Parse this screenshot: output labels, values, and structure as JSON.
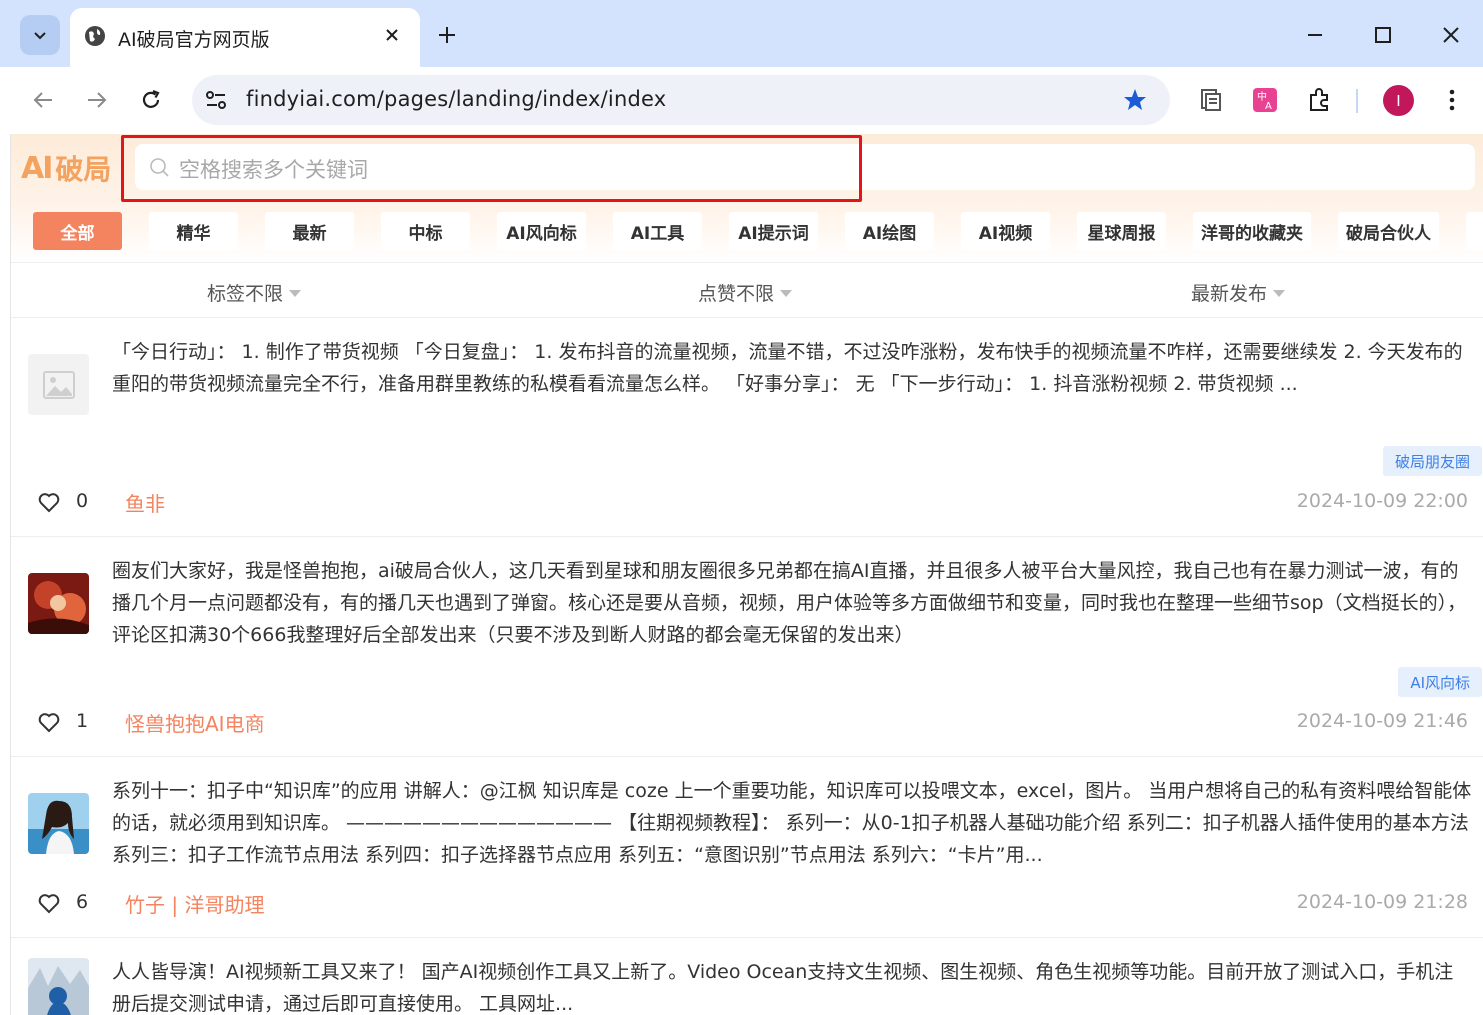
{
  "browser": {
    "tab_title": "AI破局官方网页版",
    "url": "findyiai.com/pages/landing/index/index",
    "profile_initial": "I",
    "accent_color": "#d3e3fd"
  },
  "header": {
    "logo_mark": "AI",
    "logo_text": "破局",
    "search_placeholder": "空格搜索多个关键词",
    "highlight_color": "#e3151a"
  },
  "categories": [
    {
      "label": "全部",
      "active": true
    },
    {
      "label": "精华"
    },
    {
      "label": "最新"
    },
    {
      "label": "中标"
    },
    {
      "label": "AI风向标"
    },
    {
      "label": "AI工具"
    },
    {
      "label": "AI提示词"
    },
    {
      "label": "AI绘图"
    },
    {
      "label": "AI视频"
    },
    {
      "label": "星球周报"
    },
    {
      "label": "洋哥的收藏夹"
    },
    {
      "label": "破局合伙人"
    }
  ],
  "filters": [
    {
      "label": "标签不限"
    },
    {
      "label": "点赞不限"
    },
    {
      "label": "最新发布"
    }
  ],
  "posts": [
    {
      "text": "「今日行动」： 1. 制作了带货视频 「今日复盘」： 1. 发布抖音的流量视频，流量不错，不过没咋涨粉，发布快手的视频流量不咋样，还需要继续发 2. 今天发布的重阳的带货视频流量完全不行，准备用群里教练的私模看看流量怎么样。 「好事分享」： 无 「下一步行动」： 1. 抖音涨粉视频 2. 带货视频 ...",
      "tag": "破局朋友圈",
      "likes": "0",
      "author": "鱼非",
      "time": "2024-10-09 22:00",
      "thumb": "placeholder-image-icon"
    },
    {
      "text": "圈友们大家好，我是怪兽抱抱，ai破局合伙人，这几天看到星球和朋友圈很多兄弟都在搞AI直播，并且很多人被平台大量风控，我自己也有在暴力测试一波，有的播几个月一点问题都没有，有的播几天也遇到了弹窗。核心还是要从音频，视频，用户体验等多方面做细节和变量，同时我也在整理一些细节sop（文档挺长的），评论区扣满30个666我整理好后全部发出来（只要不涉及到断人财路的都会毫无保留的发出来）",
      "tag": "AI风向标",
      "likes": "1",
      "author": "怪兽抱抱AI电商",
      "time": "2024-10-09 21:46",
      "thumb": "avatar-red"
    },
    {
      "text": "系列十一：扣子中“知识库”的应用 讲解人：@江枫 知识库是 coze 上一个重要功能，知识库可以投喂文本，excel，图片。 当用户想将自己的私有资料喂给智能体的话，就必须用到知识库。 —————————————— 【往期视频教程】： 系列一：从0-1扣子机器人基础功能介绍 系列二：扣子机器人插件使用的基本方法 系列三：扣子工作流节点用法 系列四：扣子选择器节点应用 系列五：“意图识别”节点用法 系列六：“卡片”用...",
      "tag": "",
      "likes": "6",
      "author": "竹子 | 洋哥助理",
      "time": "2024-10-09 21:28",
      "thumb": "avatar-girl"
    },
    {
      "text": "人人皆导演！AI视频新工具又来了！ 国产AI视频创作工具又上新了。Video Ocean支持文生视频、图生视频、角色生视频等功能。目前开放了测试入口，手机注册后提交测试申请，通过后即可直接使用。 工具网址...",
      "tag": "",
      "likes": "",
      "author": "",
      "time": "",
      "thumb": "avatar-snow"
    }
  ]
}
